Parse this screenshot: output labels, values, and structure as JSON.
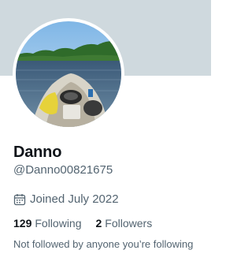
{
  "profile": {
    "display_name": "Danno",
    "handle": "@Danno00821675",
    "joined": "Joined July 2022",
    "avatar_icon": "profile-photo-kayak-lake",
    "banner_color": "#cfd9de"
  },
  "stats": {
    "following_count": "129",
    "following_label": "Following",
    "followers_count": "2",
    "followers_label": "Followers"
  },
  "followers_note": "Not followed by anyone you’re following"
}
